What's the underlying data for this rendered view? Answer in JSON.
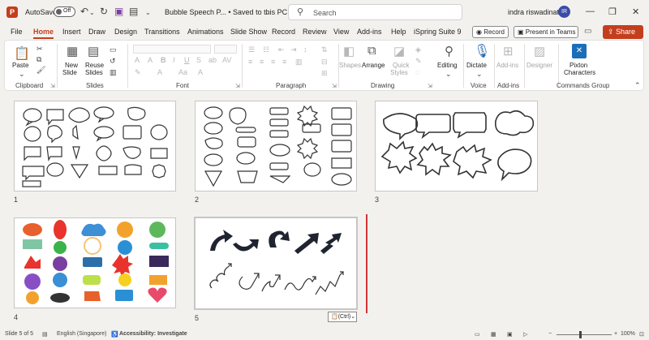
{
  "titlebar": {
    "autosave_label": "AutoSave",
    "autosave_state": "Off",
    "document": "Bubble Speech P... • Saved to this PC",
    "search_placeholder": "Search",
    "user_name": "indra riswadinata",
    "user_initials": "IR"
  },
  "menu": {
    "items": [
      "File",
      "Home",
      "Insert",
      "Draw",
      "Design",
      "Transitions",
      "Animations",
      "Slide Show",
      "Record",
      "Review",
      "View",
      "Add-ins",
      "Help",
      "iSpring Suite 9"
    ],
    "active": "Home",
    "record_label": "Record",
    "present_label": "Present in Teams",
    "share_label": "Share"
  },
  "ribbon": {
    "groups": {
      "clipboard": "Clipboard",
      "slides": "Slides",
      "font": "Font",
      "paragraph": "Paragraph",
      "drawing": "Drawing",
      "voice": "Voice",
      "addins": "Add-ins",
      "commands": "Commands Group"
    },
    "buttons": {
      "paste": "Paste",
      "new_slide_1": "New",
      "new_slide_2": "Slide",
      "reuse_slides_1": "Reuse",
      "reuse_slides_2": "Slides",
      "shapes": "Shapes",
      "arrange": "Arrange",
      "quick_styles_1": "Quick",
      "quick_styles_2": "Styles",
      "editing": "Editing",
      "dictate": "Dictate",
      "addins": "Add-ins",
      "designer": "Designer",
      "pixton_1": "Pixton",
      "pixton_2": "Characters"
    }
  },
  "slides": [
    {
      "number": "1"
    },
    {
      "number": "2"
    },
    {
      "number": "3"
    },
    {
      "number": "4"
    },
    {
      "number": "5"
    }
  ],
  "paste_options": "(Ctrl)",
  "status": {
    "slide_of": "Slide 5 of 5",
    "language": "English (Singapore)",
    "accessibility": "Accessibility: Investigate",
    "zoom": "100%"
  },
  "colors": {
    "accent": "#c43e1c",
    "insert_line": "#d13438"
  }
}
